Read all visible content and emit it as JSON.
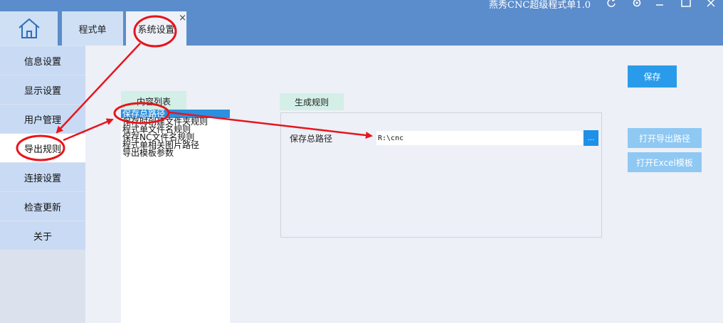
{
  "app": {
    "title": "燕秀CNC超级程式单1.0",
    "window_controls": [
      "refresh-icon",
      "gear-icon",
      "minimize-icon",
      "maximize-icon",
      "close-icon"
    ]
  },
  "tabs": [
    {
      "label": "程式单"
    },
    {
      "label": "系统设置",
      "close_label": "×",
      "active": true
    }
  ],
  "sidebar": {
    "items": [
      {
        "label": "信息设置"
      },
      {
        "label": "显示设置"
      },
      {
        "label": "用户管理"
      },
      {
        "label": "导出规则",
        "active": true
      },
      {
        "label": "连接设置"
      },
      {
        "label": "检查更新"
      },
      {
        "label": "关于"
      }
    ]
  },
  "content_list": {
    "header": "内容列表",
    "items": [
      "保存总路径",
      "保存时创建文件夹规则",
      "程式单文件名规则",
      "保存NC文件名规则",
      "程式单相关图片路径",
      "导出模板参数"
    ],
    "selected_index": 0
  },
  "rule_panel": {
    "header": "生成规则",
    "path_label": "保存总路径",
    "path_value": "R:\\cnc",
    "browse_label": "..."
  },
  "buttons": {
    "save": "保存",
    "open_export_path": "打开导出路径",
    "open_excel_template": "打开Excel模板"
  },
  "colors": {
    "titlebar": "#5b8ccb",
    "accent_button": "#2a9bea",
    "disabled_button": "#8ec8f3",
    "selection": "#2c8fe0",
    "annotation_red": "#e8141b"
  }
}
